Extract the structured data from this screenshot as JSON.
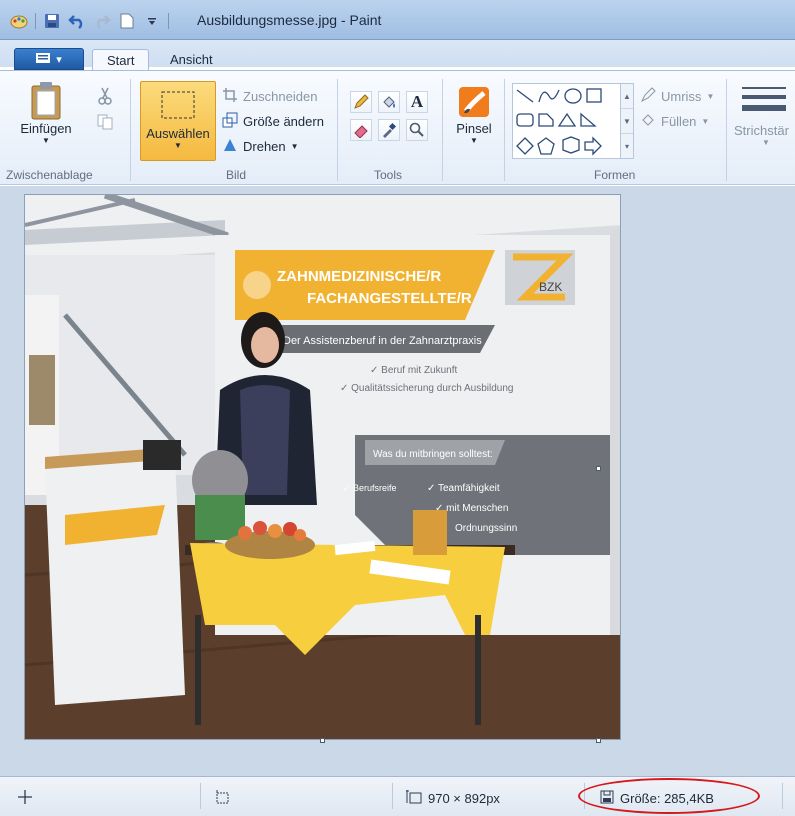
{
  "window": {
    "title": "Ausbildungsmesse.jpg - Paint"
  },
  "tabs": [
    {
      "label": "Start",
      "active": true
    },
    {
      "label": "Ansicht",
      "active": false
    }
  ],
  "ribbon": {
    "clipboard": {
      "paste_label": "Einfügen",
      "group_label": "Zwischenablage"
    },
    "image": {
      "select_label": "Auswählen",
      "crop_label": "Zuschneiden",
      "resize_label": "Größe ändern",
      "rotate_label": "Drehen",
      "group_label": "Bild"
    },
    "tools": {
      "group_label": "Tools"
    },
    "brushes": {
      "label": "Pinsel"
    },
    "shapes": {
      "outline_label": "Umriss",
      "fill_label": "Füllen",
      "group_label": "Formen"
    },
    "size": {
      "label": "Strichstär"
    }
  },
  "photo": {
    "banner_line1": "ZAHNMEDIZINISCHE/R",
    "banner_line2": "FACHANGESTELLTE/R",
    "subtitle": "Der Assistenzberuf in der Zahnarztpraxis",
    "bullet1": "✓ Beruf mit Zukunft",
    "bullet2": "✓ Qualitätssicherung durch Ausbildung",
    "requirements": "Was du mitbringen solltest:",
    "req1": "✓ Berufsreife",
    "req2": "✓ Teamfähigkeit",
    "req3": "✓ mit Menschen",
    "req4": "Ordnungssinn",
    "logo": "BZK"
  },
  "statusbar": {
    "dimensions": "970 × 892px",
    "file_size": "Größe: 285,4KB"
  },
  "colors": {
    "ribbon_accent": "#f9c44a",
    "highlight": "#d6171c",
    "banner": "#f2b231"
  }
}
